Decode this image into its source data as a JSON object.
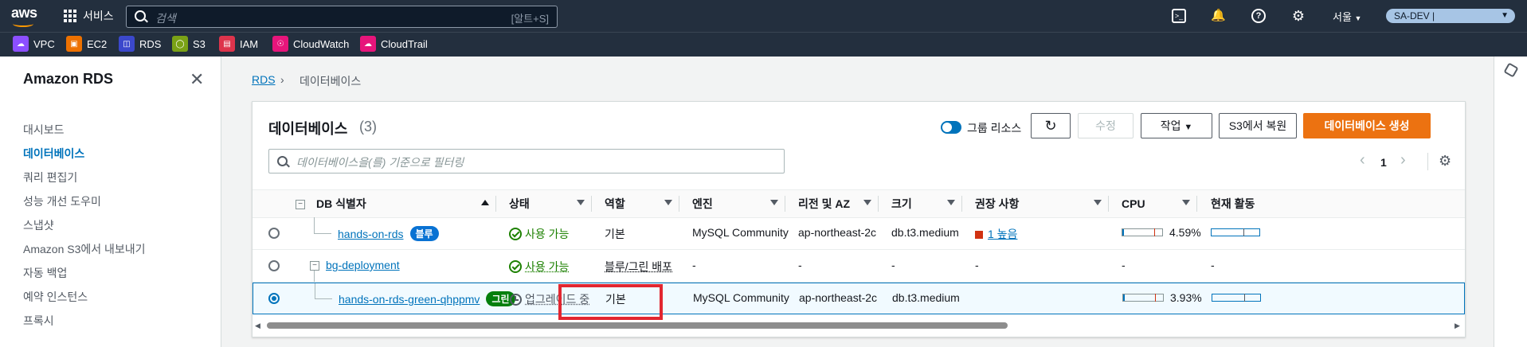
{
  "topnav": {
    "logo": "aws",
    "services_label": "서비스",
    "search_placeholder": "검색",
    "search_shortcut": "[알트+S]",
    "region": "서울",
    "account": "SA-DEV |"
  },
  "favorites": [
    {
      "label": "VPC",
      "color": "#8c4fff",
      "icon": "vpc-icon"
    },
    {
      "label": "EC2",
      "color": "#ed7100",
      "icon": "ec2-icon"
    },
    {
      "label": "RDS",
      "color": "#3b48cc",
      "icon": "rds-icon"
    },
    {
      "label": "S3",
      "color": "#7aa116",
      "icon": "s3-icon"
    },
    {
      "label": "IAM",
      "color": "#dd344c",
      "icon": "iam-icon"
    },
    {
      "label": "CloudWatch",
      "color": "#e7157b",
      "icon": "cloudwatch-icon"
    },
    {
      "label": "CloudTrail",
      "color": "#e7157b",
      "icon": "cloudtrail-icon"
    }
  ],
  "sidebar": {
    "title": "Amazon RDS",
    "items": [
      "대시보드",
      "데이터베이스",
      "쿼리 편집기",
      "성능 개선 도우미",
      "스냅샷",
      "Amazon S3에서 내보내기",
      "자동 백업",
      "예약 인스턴스",
      "프록시"
    ],
    "active_index": 1
  },
  "breadcrumb": {
    "root": "RDS",
    "current": "데이터베이스"
  },
  "panel": {
    "title": "데이터베이스",
    "count": "(3)",
    "group_label": "그룹 리소스",
    "modify_label": "수정",
    "actions_label": "작업",
    "restore_label": "S3에서 복원",
    "create_label": "데이터베이스 생성",
    "filter_placeholder": "데이터베이스을(를) 기준으로 필터링",
    "page": "1"
  },
  "columns": [
    "DB 식별자",
    "상태",
    "역할",
    "엔진",
    "리전 및 AZ",
    "크기",
    "권장 사항",
    "CPU",
    "현재 활동"
  ],
  "rows": [
    {
      "id": "hands-on-rds",
      "badge": "블루",
      "badge_color": "#0972d3",
      "status": "사용 가능",
      "status_kind": "ok",
      "role": "기본",
      "engine": "MySQL Community",
      "region": "ap-northeast-2c",
      "size": "db.t3.medium",
      "rec": "1 높음",
      "cpu": "4.59%",
      "cpu_pct": 4.59
    },
    {
      "id": "bg-deployment",
      "badge": "",
      "status": "사용 가능",
      "status_kind": "ok",
      "role": "블루/그린 배포",
      "engine": "-",
      "region": "-",
      "size": "-",
      "rec": "-",
      "cpu": "-",
      "activity": "-"
    },
    {
      "id": "hands-on-rds-green-qhppmv",
      "badge": "그린",
      "badge_color": "#037f0c",
      "status": "업그레이드 중",
      "status_kind": "progress",
      "role": "기본",
      "engine": "MySQL Community",
      "region": "ap-northeast-2c",
      "size": "db.t3.medium",
      "rec": "",
      "cpu": "3.93%",
      "cpu_pct": 3.93
    }
  ]
}
